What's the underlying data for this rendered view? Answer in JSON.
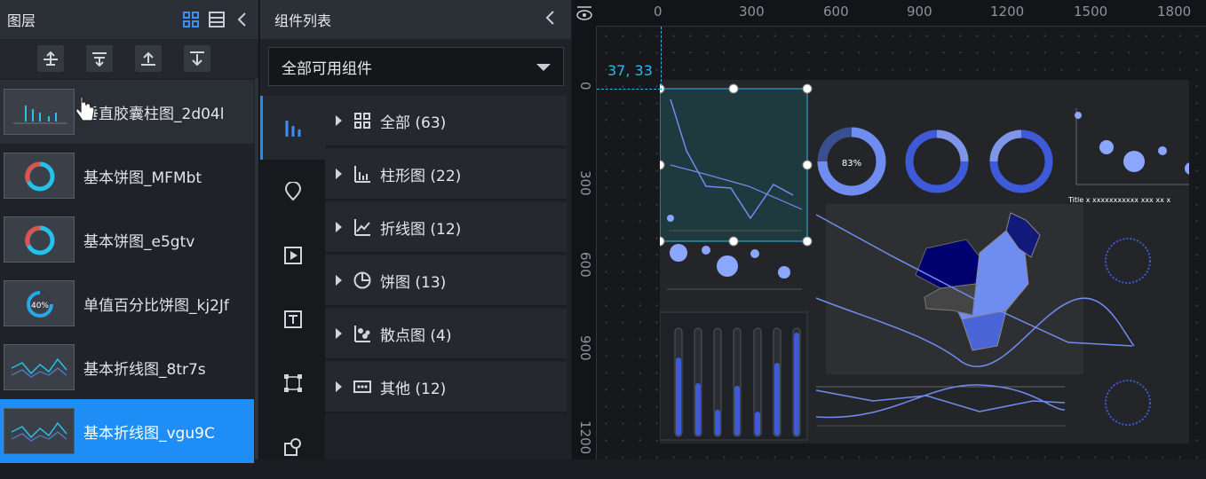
{
  "layers": {
    "title": "图层",
    "items": [
      {
        "label": "垂直胶囊柱图_2d04l",
        "thumb": "bar"
      },
      {
        "label": "基本饼图_MFMbt",
        "thumb": "ring"
      },
      {
        "label": "基本饼图_e5gtv",
        "thumb": "ring"
      },
      {
        "label": "单值百分比饼图_kj2Jf",
        "thumb": "pct",
        "pct_text": "40%"
      },
      {
        "label": "基本折线图_8tr7s",
        "thumb": "line"
      },
      {
        "label": "基本折线图_vgu9C",
        "thumb": "line"
      }
    ]
  },
  "components": {
    "title": "组件列表",
    "dropdown": "全部可用组件",
    "categories": [
      {
        "label": "全部 (63)"
      },
      {
        "label": "柱形图 (22)"
      },
      {
        "label": "折线图 (12)"
      },
      {
        "label": "饼图 (13)"
      },
      {
        "label": "散点图 (4)"
      },
      {
        "label": "其他 (12)"
      }
    ]
  },
  "canvas": {
    "ruler_x": [
      "0",
      "300",
      "600",
      "900",
      "1200",
      "1500",
      "1800"
    ],
    "ruler_y": [
      "0",
      "300",
      "600",
      "900",
      "1200"
    ],
    "coords": "37, 33",
    "donut_label": "83%",
    "scatter_title": "Title x xxxxxxxxxxx xxx xx x"
  },
  "colors": {
    "accent": "#1e8df5",
    "selection": "#2fb8e6",
    "chart": "#6f8cf0"
  }
}
